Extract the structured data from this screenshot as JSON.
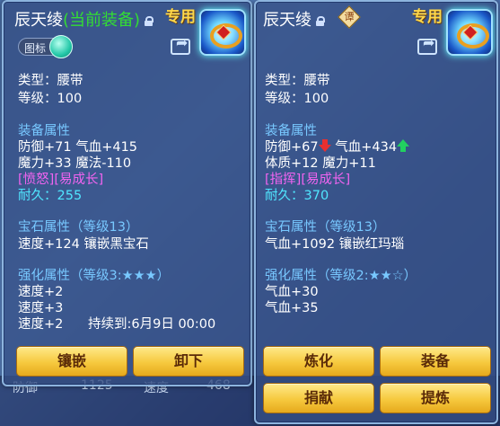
{
  "left_panel": {
    "title": "辰天绫",
    "title_suffix": "(当前装备)",
    "special_label": "专用",
    "toggle_label": "图标",
    "type_line": "类型：腰带",
    "level_line": "等级：100",
    "equip_header": "装备属性",
    "equip_lines": [
      "防御+71 气血+415",
      "魔力+33 魔法-110"
    ],
    "tags_line": "[愤怒][易成长]",
    "durability_line": "耐久：255",
    "gem_header": "宝石属性（等级13）",
    "gem_line": "速度+124 镶嵌黑宝石",
    "enhance_header": "强化属性（等级3:★★★）",
    "enhance_lines": [
      "速度+2",
      "速度+3"
    ],
    "enhance_last_value": "速度+2",
    "enhance_last_duration": "持续到:6月9日 00:00",
    "buttons": [
      "镶嵌",
      "卸下"
    ]
  },
  "right_panel": {
    "title": "辰天绫",
    "badge_char": "谭",
    "special_label": "专用",
    "type_line": "类型：腰带",
    "level_line": "等级：100",
    "equip_header": "装备属性",
    "equip_line1_a": "防御+67",
    "equip_line1_b": "气血+434",
    "equip_line2": "体质+12 魔力+11",
    "tags_line": "[指挥][易成长]",
    "durability_line": "耐久：370",
    "gem_header": "宝石属性（等级13）",
    "gem_line": "气血+1092 镶嵌红玛瑙",
    "enhance_header": "强化属性（等级2:★★☆）",
    "enhance_lines": [
      "气血+30",
      "气血+35"
    ],
    "buttons": [
      "炼化",
      "装备",
      "捐献",
      "提炼"
    ]
  },
  "background": {
    "stat_left_label": "防御",
    "stat_left_value": "1125",
    "stat_right_label": "速度",
    "stat_right_value": "468"
  },
  "colors": {
    "title_sub": "#33dd33",
    "header": "#78c8ff",
    "tags": "#f064f0",
    "durability": "#50e6ff",
    "special": "#ffd84a",
    "button": "#f6c93e"
  }
}
